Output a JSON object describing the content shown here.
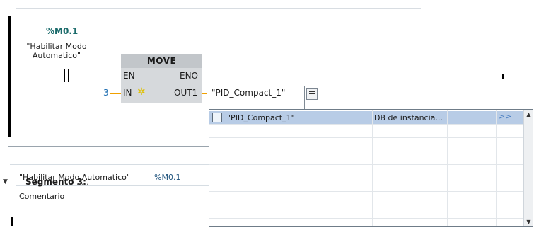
{
  "contact": {
    "address": "%M0.1",
    "symbol_line1": "\"Habilitar Modo",
    "symbol_line2": "Automatico\""
  },
  "move_block": {
    "title": "MOVE",
    "pin_en": "EN",
    "pin_eno": "ENO",
    "pin_in": "IN",
    "pin_out1": "OUT1",
    "in_value": "3"
  },
  "out_operand": {
    "value": "\"PID_Compact_1\""
  },
  "tag_info": {
    "symbol": "\"Habilitar Modo Automatico\"",
    "address": "%M0.1"
  },
  "segment": {
    "title": "Segmento 3:",
    "dots": ".....",
    "comment": "Comentario"
  },
  "dropdown": {
    "items": [
      {
        "name": "\"PID_Compact_1\"",
        "type": "DB de instancia...",
        "more": ">>"
      }
    ]
  },
  "colors": {
    "accent_teal": "#1b6b6b",
    "selection": "#b8cce6",
    "wire_orange": "#f0a000",
    "block_gray": "#d6d9dc"
  }
}
